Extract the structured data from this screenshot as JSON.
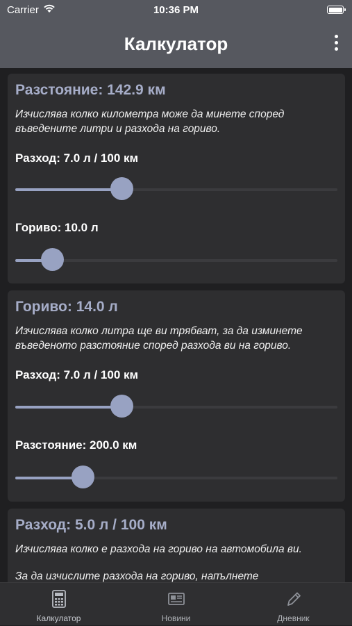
{
  "status_bar": {
    "carrier": "Carrier",
    "time": "10:36 PM"
  },
  "navbar": {
    "title": "Калкулатор",
    "menu_icon": "more-vertical-icon"
  },
  "cards": [
    {
      "title": "Разстояние: 142.9 км",
      "description": "Изчислява колко километра може да минете според въведените литри и разхода на гориво.",
      "sliders": [
        {
          "label": "Разход: 7.0 л / 100 км",
          "level": 0.33
        },
        {
          "label": "Гориво: 10.0 л",
          "level": 0.115
        }
      ]
    },
    {
      "title": "Гориво: 14.0 л",
      "description": "Изчислява колко литра ще ви трябват, за да изминете въведеното разстояние според разхода ви на гориво.",
      "sliders": [
        {
          "label": "Разход: 7.0 л / 100 км",
          "level": 0.33
        },
        {
          "label": "Разстояние: 200.0 км",
          "level": 0.21
        }
      ]
    },
    {
      "title": "Разход: 5.0 л / 100 км",
      "description": "Изчислява колко е разхода на гориво на автомобила ви.",
      "description2": "За да изчислите разхода на гориво, напълнете"
    }
  ],
  "tabbar": {
    "items": [
      {
        "label": "Калкулатор",
        "icon": "calculator-icon",
        "active": true
      },
      {
        "label": "Новини",
        "icon": "newspaper-icon",
        "active": false
      },
      {
        "label": "Дневник",
        "icon": "pencil-icon",
        "active": false
      }
    ]
  },
  "colors": {
    "accent": "#98a2c2",
    "title": "#a6adc8",
    "bar": "#56585f",
    "card": "#2e2e30",
    "background": "#1f1f21"
  }
}
